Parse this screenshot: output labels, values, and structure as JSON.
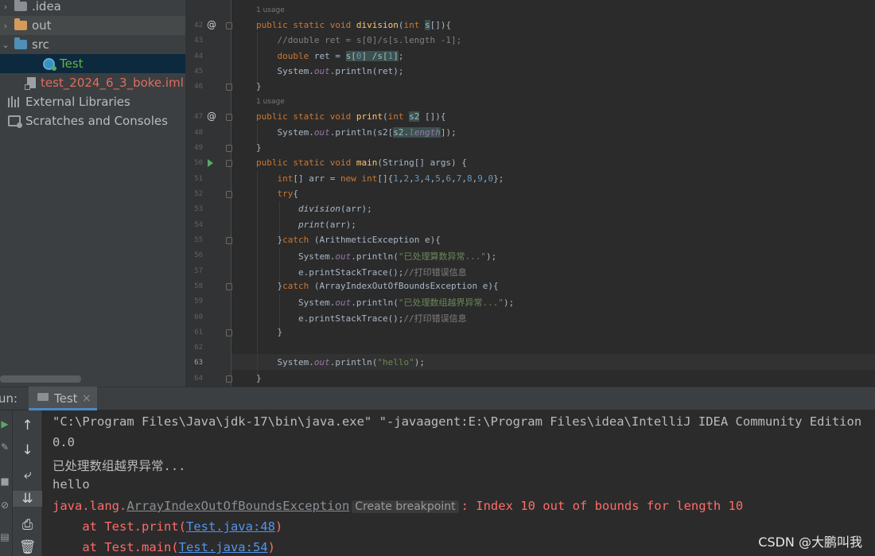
{
  "project_tree": [
    {
      "label": ".idea",
      "arrow": "›",
      "type": "folder-grey",
      "style": "normal"
    },
    {
      "label": "out",
      "arrow": "›",
      "type": "folder-orange",
      "style": "normal"
    },
    {
      "label": "src",
      "arrow": "⌄",
      "type": "folder-blue",
      "style": "normal"
    },
    {
      "label": "Test",
      "arrow": "",
      "type": "class",
      "style": "green"
    },
    {
      "label": "test_2024_6_3_boke.iml",
      "arrow": "",
      "type": "file",
      "style": "red"
    },
    {
      "label": "External Libraries",
      "arrow": "",
      "type": "libs",
      "style": "normal"
    },
    {
      "label": "Scratches and Consoles",
      "arrow": "",
      "type": "scratch",
      "style": "normal"
    }
  ],
  "editor": {
    "usage_hint": "1 usage",
    "line_numbers": [
      "42",
      "43",
      "44",
      "45",
      "46",
      "47",
      "48",
      "49",
      "50",
      "51",
      "52",
      "53",
      "54",
      "55",
      "56",
      "57",
      "58",
      "59",
      "60",
      "61",
      "62",
      "63",
      "64"
    ]
  },
  "run_panel": {
    "label": "un:",
    "tab_label": "Test",
    "tab_close": "×"
  },
  "console": {
    "line1": "\"C:\\Program Files\\Java\\jdk-17\\bin\\java.exe\" \"-javaagent:E:\\Program Files\\idea\\IntelliJ IDEA Community Edition",
    "line2": "0.0",
    "line3": "已处理数组越界异常...",
    "line4": "hello",
    "exc_prefix": "java.lang.",
    "exc_class": "ArrayIndexOutOfBoundsException",
    "breakpoint_hint": "Create breakpoint",
    "exc_message": ": Index 10 out of bounds for length 10",
    "at1_prefix": "    at Test.print(",
    "at1_link": "Test.java:48",
    "at2_prefix": "    at Test.main(",
    "at2_link": "Test.java:54",
    "close_paren": ")"
  },
  "watermark": "CSDN @大鹏叫我"
}
